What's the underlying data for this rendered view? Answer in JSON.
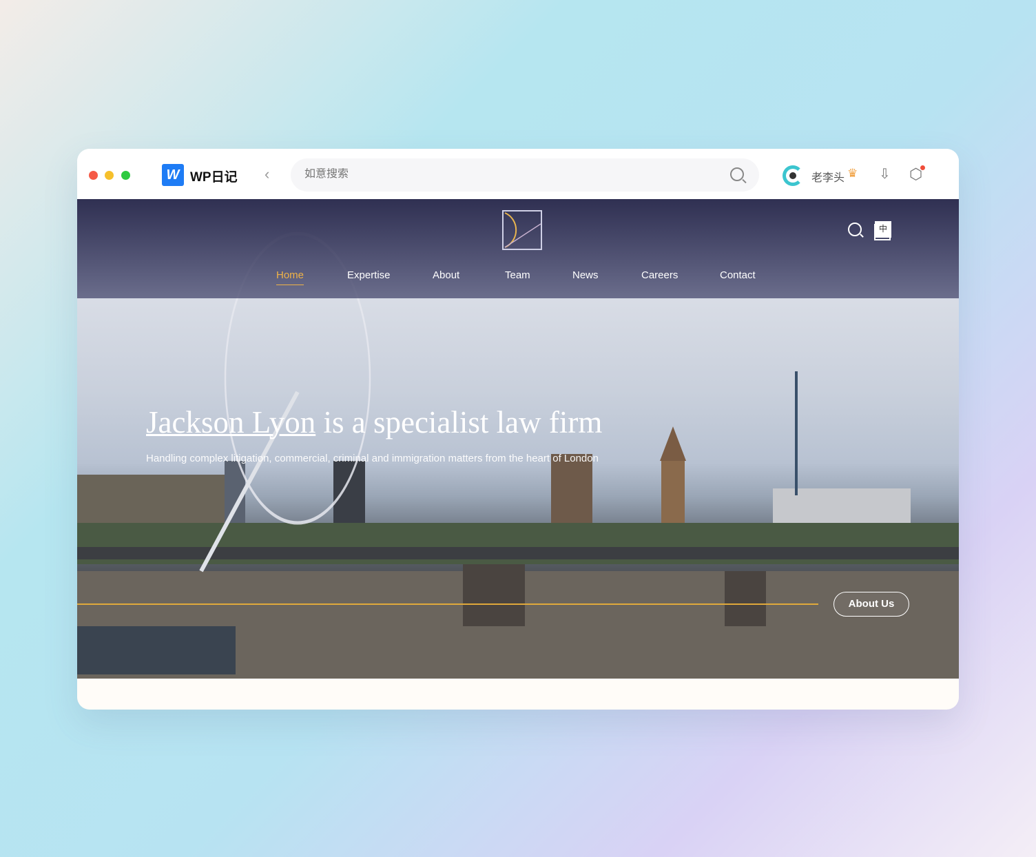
{
  "browser": {
    "brand": "WP日记",
    "search_placeholder": "如意搜索",
    "username": "老李头",
    "icons": [
      "back-chevron-icon",
      "search-icon",
      "avatar-icon",
      "crown-icon",
      "download-icon",
      "settings-icon"
    ],
    "dot_colors": [
      "#f55a47",
      "#f6c02c",
      "#2dca3f"
    ]
  },
  "site": {
    "nav": [
      "Home",
      "Expertise",
      "About",
      "Team",
      "News",
      "Careers",
      "Contact"
    ],
    "active": "Home",
    "lang": "中",
    "headline_link": "Jackson Lyon",
    "headline_rest": " is a specialist law firm",
    "subtitle": "Handling complex litigation, commercial, criminal and immigration matters from the heart of London",
    "cta": "About Us",
    "accent": "#f0b347"
  }
}
